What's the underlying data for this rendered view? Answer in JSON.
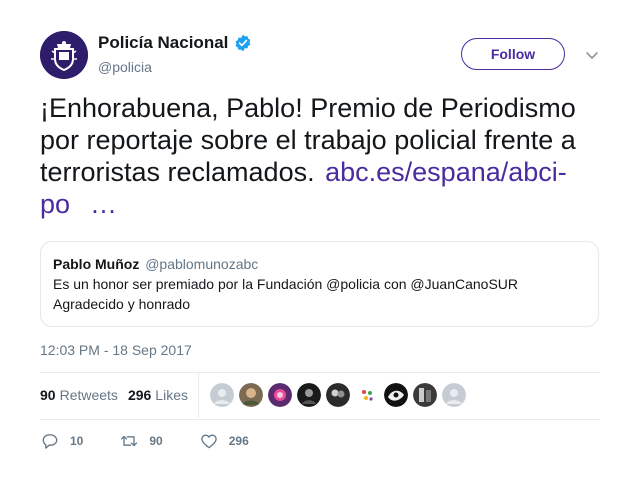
{
  "author": {
    "display_name": "Policía Nacional",
    "handle": "@policia",
    "verified_icon": "verified-badge-icon",
    "avatar_icon": "police-crest-icon"
  },
  "follow_label": "Follow",
  "tweet": {
    "text": "¡Enhorabuena, Pablo! Premio de Periodismo por reportaje sobre el trabajo policial frente a terroristas reclamados.",
    "link": "abc.es/espana/abci-po",
    "ellipsis": "…"
  },
  "quoted": {
    "name": "Pablo Muñoz",
    "handle": "@pablomunozabc",
    "line1": "Es un honor ser premiado por la Fundación @policia con @JuanCanoSUR",
    "line2": "Agradecido y honrado"
  },
  "timestamp": "12:03 PM - 18 Sep 2017",
  "stats": {
    "retweets_count": "90",
    "retweets_label": "Retweets",
    "likes_count": "296",
    "likes_label": "Likes"
  },
  "actions": {
    "reply_count": "10",
    "retweet_count": "90",
    "like_count": "296"
  },
  "colors": {
    "accent": "#4a2ca0",
    "verified": "#1da1f2",
    "muted": "#657786"
  }
}
